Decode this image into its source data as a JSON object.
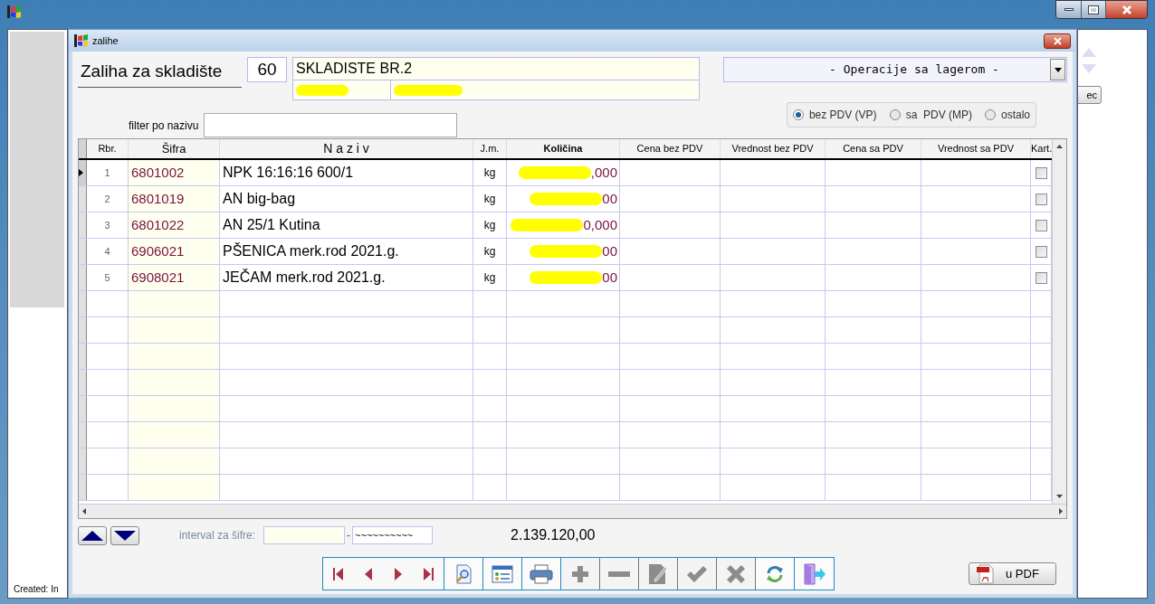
{
  "outer_window": {
    "footer_text": "Created:  In",
    "side_button": "ec"
  },
  "window": {
    "title": "zalihe"
  },
  "header": {
    "title": "Zaliha za skladište",
    "warehouse_code": "60",
    "warehouse_name": "SKLADISTE BR.2",
    "operations_dropdown": "- Operacije sa lagerom -"
  },
  "filter": {
    "label": "filter po nazivu"
  },
  "price_mode": [
    {
      "label": "bez PDV (VP)",
      "selected": true
    },
    {
      "label": "sa  PDV (MP)",
      "selected": false
    },
    {
      "label": "ostalo",
      "selected": false
    }
  ],
  "table": {
    "columns": [
      "Rbr.",
      "Šifra",
      "N a z i v",
      "J.m.",
      "Količina",
      "Cena bez PDV",
      "Vrednost bez PDV",
      "Cena sa PDV",
      "Vrednost sa PDV",
      "Kart."
    ],
    "rows": [
      {
        "rbr": "1",
        "sifra": "6801002",
        "naziv": "NPK 16:16:16 600/1",
        "jm": "kg",
        "quantity_visible": ",000",
        "selected": true,
        "checked": false
      },
      {
        "rbr": "2",
        "sifra": "6801019",
        "naziv": "AN big-bag",
        "jm": "kg",
        "quantity_visible": "00",
        "selected": false,
        "checked": false
      },
      {
        "rbr": "3",
        "sifra": "6801022",
        "naziv": "AN 25/1 Kutina",
        "jm": "kg",
        "quantity_visible": "0,000",
        "selected": false,
        "checked": false
      },
      {
        "rbr": "4",
        "sifra": "6906021",
        "naziv": "PŠENICA merk.rod 2021.g.",
        "jm": "kg",
        "quantity_visible": "00",
        "selected": false,
        "checked": false
      },
      {
        "rbr": "5",
        "sifra": "6908021",
        "naziv": "JEČAM merk.rod 2021.g.",
        "jm": "kg",
        "quantity_visible": "00",
        "selected": false,
        "checked": false
      }
    ]
  },
  "footer": {
    "interval_label": "interval za šifre:",
    "range_separator": "-",
    "interval_to": "~~~~~~~~~~",
    "total": "2.139.120,00",
    "pdf_button": "u PDF"
  },
  "toolbar": [
    {
      "kind": "first",
      "disabled": false
    },
    {
      "kind": "prev",
      "disabled": false
    },
    {
      "kind": "next",
      "disabled": false
    },
    {
      "kind": "last",
      "disabled": false
    },
    {
      "kind": "preview",
      "disabled": false
    },
    {
      "kind": "form",
      "disabled": false
    },
    {
      "kind": "print",
      "disabled": false
    },
    {
      "kind": "add",
      "disabled": true
    },
    {
      "kind": "remove",
      "disabled": true
    },
    {
      "kind": "edit",
      "disabled": true
    },
    {
      "kind": "confirm",
      "disabled": true
    },
    {
      "kind": "cancel",
      "disabled": true
    },
    {
      "kind": "refresh",
      "disabled": false
    },
    {
      "kind": "exit",
      "disabled": false
    }
  ]
}
